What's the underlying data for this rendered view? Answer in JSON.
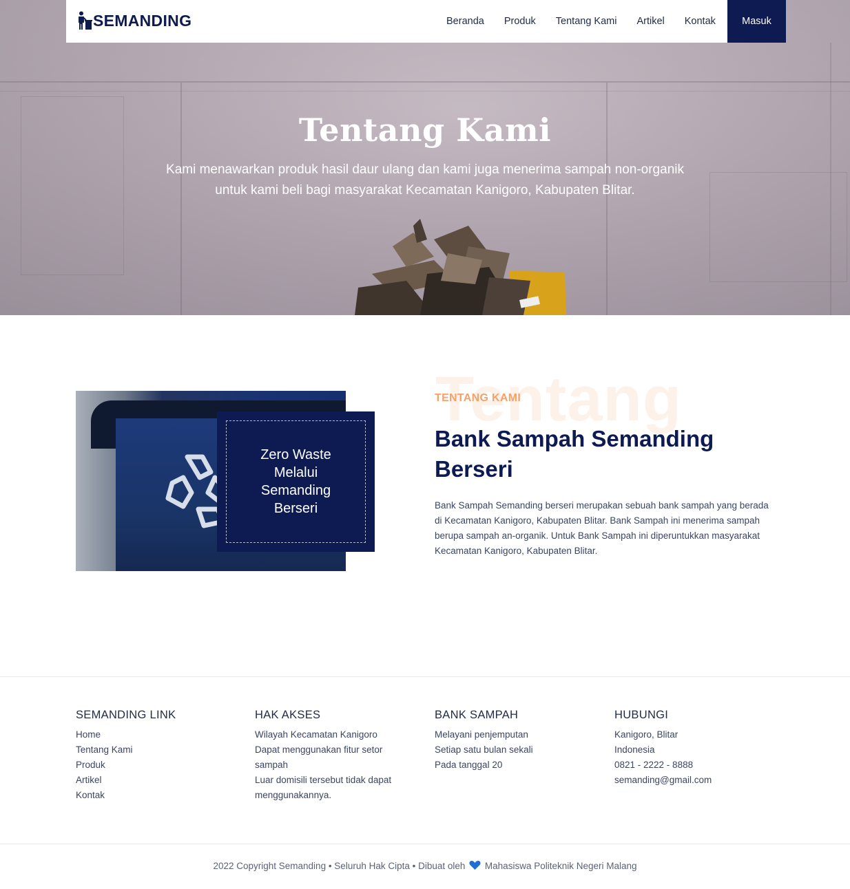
{
  "brand": {
    "name": "SEMANDING",
    "logo_icon": "person-trash-icon"
  },
  "nav": {
    "links": [
      "Beranda",
      "Produk",
      "Tentang Kami",
      "Artikel",
      "Kontak"
    ],
    "login_label": "Masuk"
  },
  "hero": {
    "title": "Tentang Kami",
    "subtitle_line1": "Kami menawarkan produk hasil daur ulang dan kami juga menerima sampah non-organik",
    "subtitle_line2": "untuk kami beli bagi masyarakat Kecamatan Kanigoro, Kabupaten Blitar."
  },
  "about": {
    "image_caption": "Zero Waste Melalui Semanding Berseri",
    "background_word": "Tentang",
    "kicker": "TENTANG KAMI",
    "title": "Bank Sampah Semanding Berseri",
    "description": "Bank Sampah Semanding berseri merupakan sebuah bank sampah yang berada di Kecamatan Kanigoro, Kabupaten Blitar. Bank Sampah ini menerima sampah berupa sampah an-organik. Untuk Bank Sampah ini diperuntukkan masyarakat Kecamatan Kanigoro, Kabupaten Blitar."
  },
  "footer": {
    "link_col": {
      "heading": "SEMANDING LINK",
      "items": [
        "Home",
        "Tentang Kami",
        "Produk",
        "Artikel",
        "Kontak"
      ]
    },
    "access_col": {
      "heading": "HAK AKSES",
      "items": [
        "Wilayah Kecamatan Kanigoro",
        "Dapat menggunakan fitur setor sampah",
        "Luar domisili tersebut tidak dapat menggunakannya."
      ]
    },
    "bank_col": {
      "heading": "BANK SAMPAH",
      "items": [
        "Melayani penjemputan",
        "Setiap satu bulan sekali",
        "Pada tanggal 20"
      ]
    },
    "contact_col": {
      "heading": "HUBUNGI",
      "items": [
        "Kanigoro, Blitar",
        "Indonesia",
        "0821 - 2222 - 8888",
        "semanding@gmail.com"
      ]
    },
    "copyright_before": "2022 Copyright Semanding • Seluruh Hak Cipta • Dibuat oleh",
    "copyright_after": "Mahasiswa Politeknik Negeri Malang"
  },
  "colors": {
    "navy": "#0d1b52",
    "accent_orange": "#f6a06a",
    "heart_blue": "#1f6fd1"
  }
}
